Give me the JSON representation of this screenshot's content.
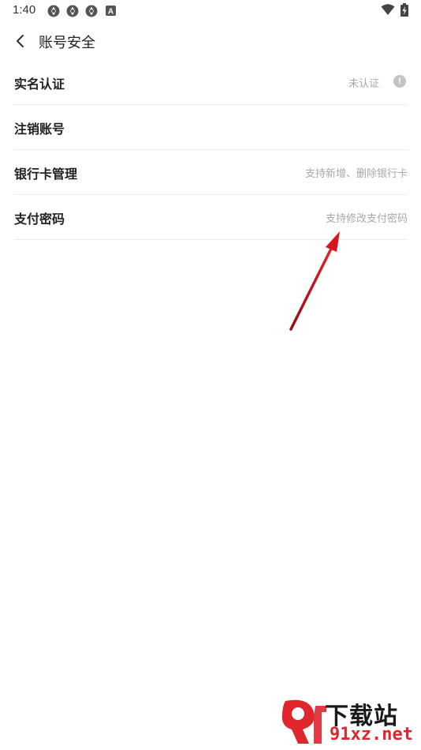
{
  "status_bar": {
    "time": "1:40",
    "icons": [
      "app-icon",
      "app-icon",
      "app-icon",
      "keyboard-a-icon",
      "wifi-icon",
      "battery-charging-icon"
    ]
  },
  "header": {
    "back_icon": "chevron-left-icon",
    "title": "账号安全"
  },
  "settings": {
    "items": [
      {
        "label": "实名认证",
        "hint": "未认证",
        "icon": "info-icon"
      },
      {
        "label": "注销账号",
        "hint": ""
      },
      {
        "label": "银行卡管理",
        "hint": "支持新增、删除银行卡"
      },
      {
        "label": "支付密码",
        "hint": "支持修改支付密码"
      }
    ]
  },
  "annotation": {
    "arrow_color": "#d8151c"
  },
  "watermark": {
    "logo_text": "9f",
    "title": "下载站",
    "url": "91xz.net",
    "accent": "#e0262d"
  }
}
